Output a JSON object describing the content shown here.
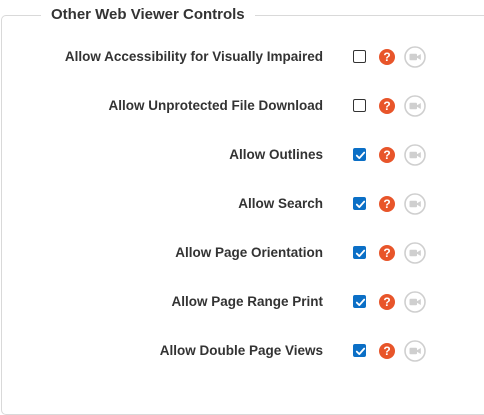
{
  "section": {
    "title": "Other Web Viewer Controls"
  },
  "rows": [
    {
      "label": "Allow Accessibility for Visually Impaired",
      "checked": false
    },
    {
      "label": "Allow Unprotected File Download",
      "checked": false
    },
    {
      "label": "Allow Outlines",
      "checked": true
    },
    {
      "label": "Allow Search",
      "checked": true
    },
    {
      "label": "Allow Page Orientation",
      "checked": true
    },
    {
      "label": "Allow Page Range Print",
      "checked": true
    },
    {
      "label": "Allow Double Page Views",
      "checked": true
    }
  ],
  "icons": {
    "help": "question-mark-icon",
    "video": "video-camera-icon"
  },
  "colors": {
    "checkbox_checked": "#0b6fc6",
    "help_icon": "#e8552a",
    "video_icon": "#cfcfcf",
    "text": "#333333",
    "border": "#d9d9d9"
  }
}
